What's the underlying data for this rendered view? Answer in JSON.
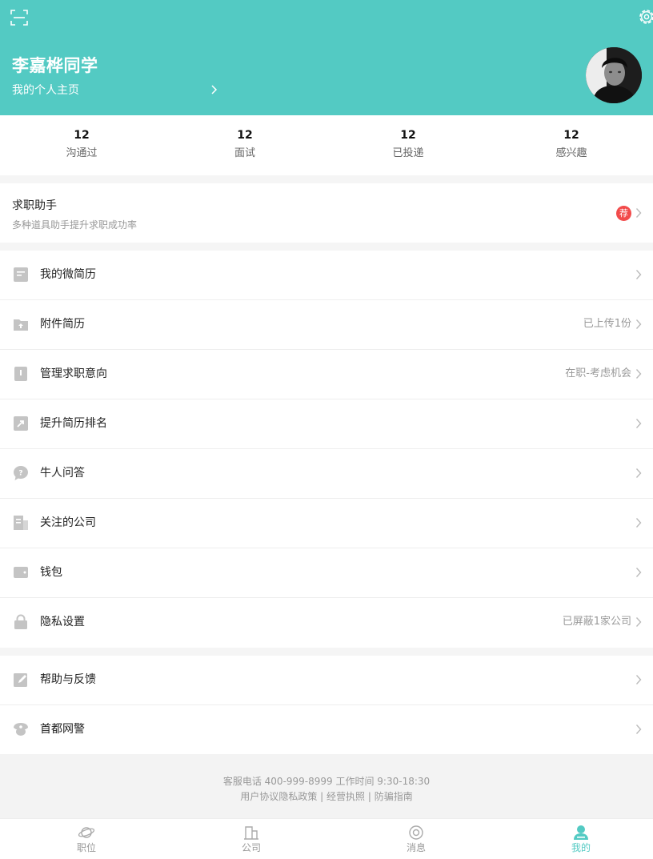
{
  "header": {
    "user_name": "李嘉桦同学",
    "homepage_label": "我的个人主页",
    "bg_color": "#53cac3"
  },
  "stats": [
    {
      "count": "12",
      "label": "沟通过"
    },
    {
      "count": "12",
      "label": "面试"
    },
    {
      "count": "12",
      "label": "已投递"
    },
    {
      "count": "12",
      "label": "感兴趣"
    }
  ],
  "assistant": {
    "title": "求职助手",
    "subtitle": "多种道具助手提升求职成功率",
    "badge": "荐"
  },
  "menu_group1": [
    {
      "label": "我的微简历",
      "value": "",
      "icon": "resume-icon"
    },
    {
      "label": "附件简历",
      "value": "已上传1份",
      "icon": "upload-folder-icon"
    },
    {
      "label": "管理求职意向",
      "value": "在职-考虑机会",
      "icon": "intention-icon"
    },
    {
      "label": "提升简历排名",
      "value": "",
      "icon": "rank-up-icon"
    },
    {
      "label": "牛人问答",
      "value": "",
      "icon": "question-icon"
    },
    {
      "label": "关注的公司",
      "value": "",
      "icon": "company-icon"
    },
    {
      "label": "钱包",
      "value": "",
      "icon": "wallet-icon"
    },
    {
      "label": "隐私设置",
      "value": "已屏蔽1家公司",
      "icon": "lock-icon"
    }
  ],
  "menu_group2": [
    {
      "label": "帮助与反馈",
      "value": "",
      "icon": "edit-icon"
    },
    {
      "label": "首都网警",
      "value": "",
      "icon": "police-icon"
    }
  ],
  "footer": {
    "hotline": "客服电话 400-999-8999 工作时间 9:30-18:30",
    "links": [
      "用户协议",
      "隐私政策",
      "经营执照",
      "防骗指南"
    ],
    "separator": " | "
  },
  "tabs": [
    {
      "label": "职位",
      "icon": "planet-icon",
      "active": false
    },
    {
      "label": "公司",
      "icon": "building-icon",
      "active": false
    },
    {
      "label": "消息",
      "icon": "message-icon",
      "active": false
    },
    {
      "label": "我的",
      "icon": "profile-icon",
      "active": true
    }
  ]
}
